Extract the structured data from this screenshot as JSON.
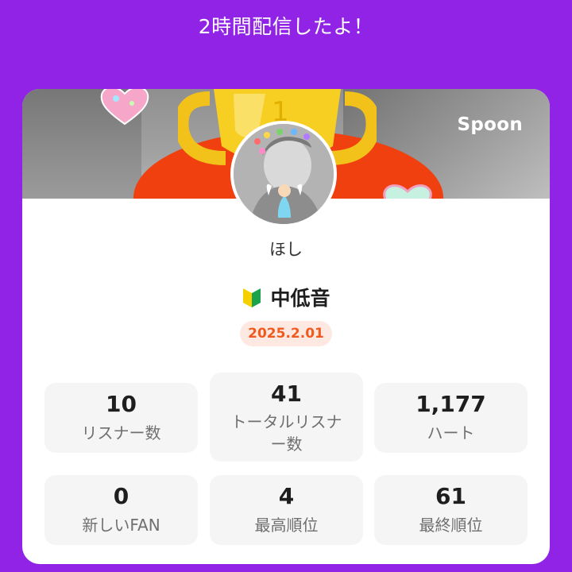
{
  "header": {
    "title": "2時間配信したよ！"
  },
  "card": {
    "brand": "Spoon",
    "username": "ほし",
    "broadcast_title": "中低音",
    "date": "2025.2.01",
    "colors": {
      "background": "#9023e6",
      "accent_orange": "#f05a1e",
      "date_bg": "#fde9e1"
    },
    "icons": [
      "trophy-icon",
      "heart-icon",
      "beginner-mark-icon",
      "avatar-image"
    ]
  },
  "stats": [
    {
      "value": "10",
      "label": "リスナー数"
    },
    {
      "value": "41",
      "label_line1": "トータルリスナ",
      "label_line2": "ー数"
    },
    {
      "value": "1,177",
      "label": "ハート"
    },
    {
      "value": "0",
      "label": "新しいFAN"
    },
    {
      "value": "4",
      "label": "最高順位"
    },
    {
      "value": "61",
      "label": "最終順位"
    }
  ]
}
